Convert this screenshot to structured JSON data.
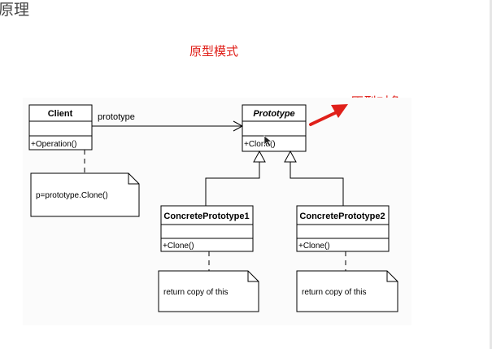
{
  "heading": "原理",
  "subtitle": "原型模式",
  "callout": "原型对象",
  "colors": {
    "accent": "#e0201a",
    "line": "#000000",
    "diagram_bg": "#fbfbfb"
  },
  "diagram": {
    "client": {
      "name": "Client",
      "operation": "+Operation()"
    },
    "association_label": "prototype",
    "prototype": {
      "name": "Prototype",
      "operation": "+Clone()"
    },
    "concrete1": {
      "name": "ConcretePrototype1",
      "operation": "+Clone()"
    },
    "concrete2": {
      "name": "ConcretePrototype2",
      "operation": "+Clone()"
    },
    "client_note": "p=prototype.Clone()",
    "concrete1_note": "return copy of this",
    "concrete2_note": "return copy of this"
  }
}
